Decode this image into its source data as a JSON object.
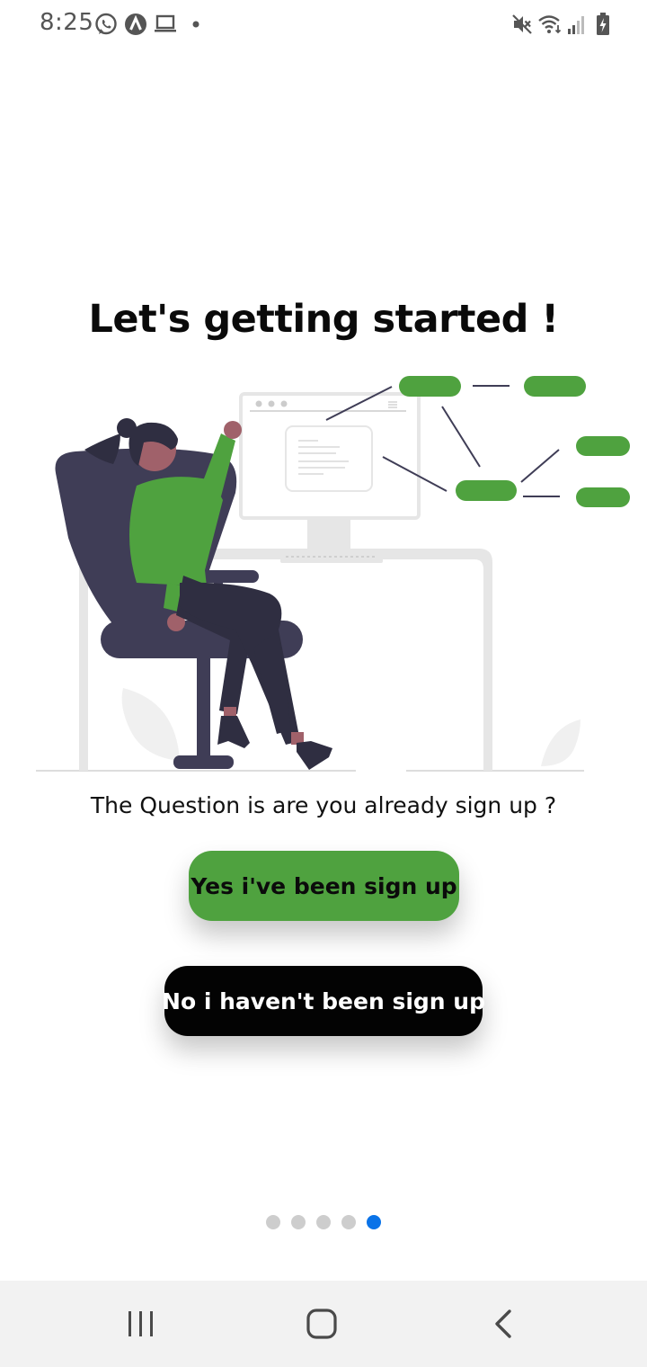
{
  "status_bar": {
    "time": "8:25",
    "left_icons": [
      "whatsapp-icon",
      "app-a-icon",
      "laptop-icon",
      "dot-icon"
    ],
    "right_icons": [
      "mute-icon",
      "wifi-icon",
      "signal-icon",
      "battery-icon"
    ]
  },
  "main": {
    "title": "Let's getting started !",
    "question": "The Question is are you already sign up ?",
    "yes_button_label": "Yes i've been sign up",
    "no_button_label": "No i haven't been sign up"
  },
  "pagination": {
    "total": 5,
    "active_index": 4
  },
  "nav_bar": {
    "buttons": [
      "recents-icon",
      "home-icon",
      "back-icon"
    ]
  },
  "colors": {
    "accent_green": "#4fa23f",
    "dark_button": "#030303",
    "active_dot": "#0a73e8",
    "inactive_dot": "#cdcdcd",
    "illustration_dark": "#3f3d56",
    "illustration_gray": "#e6e6e6"
  }
}
